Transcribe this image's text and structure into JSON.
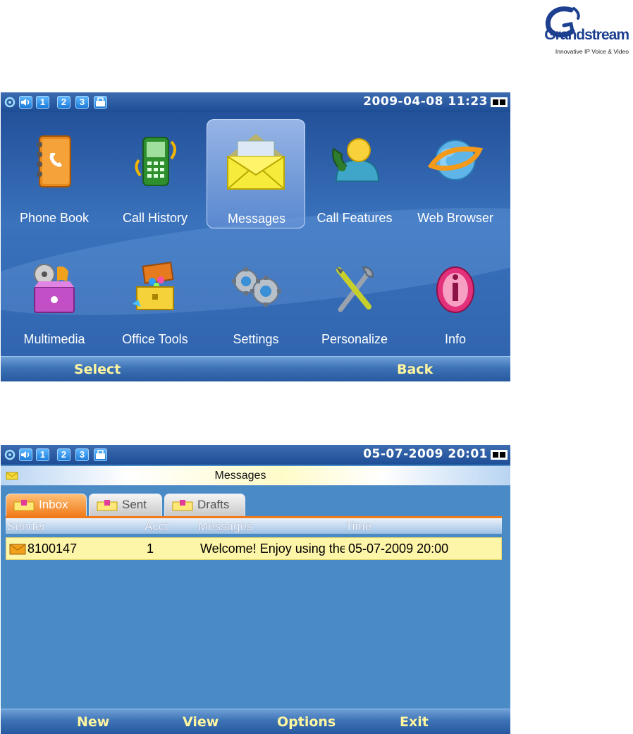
{
  "brand": {
    "logo_word": "Grandstream",
    "tagline": "Innovative IP Voice & Video"
  },
  "screen1": {
    "status": {
      "line_keys": [
        "1",
        "2",
        "3"
      ],
      "datetime": "2009-04-08 11:23"
    },
    "menu": [
      {
        "label": "Phone Book",
        "icon": "phone-book-icon"
      },
      {
        "label": "Call History",
        "icon": "call-history-icon"
      },
      {
        "label": "Messages",
        "icon": "envelope-icon",
        "selected": true
      },
      {
        "label": "Call Features",
        "icon": "call-features-icon"
      },
      {
        "label": "Web Browser",
        "icon": "web-browser-icon"
      },
      {
        "label": "Multimedia",
        "icon": "multimedia-icon"
      },
      {
        "label": "Office Tools",
        "icon": "toolbox-icon"
      },
      {
        "label": "Settings",
        "icon": "gears-icon"
      },
      {
        "label": "Personalize",
        "icon": "tools-icon"
      },
      {
        "label": "Info",
        "icon": "info-icon"
      }
    ],
    "softkeys": {
      "left": "Select",
      "right": "Back"
    }
  },
  "screen2": {
    "status": {
      "line_keys": [
        "1",
        "2",
        "3"
      ],
      "datetime": "05-07-2009 20:01"
    },
    "title": "Messages",
    "tabs": [
      {
        "label": "Inbox",
        "active": true
      },
      {
        "label": "Sent",
        "active": false
      },
      {
        "label": "Drafts",
        "active": false
      }
    ],
    "columns": [
      "Sender",
      "Acct",
      "Messages",
      "Time"
    ],
    "rows": [
      {
        "sender": "8100147",
        "acct": "1",
        "message": "Welcome! Enjoy using the",
        "time": "05-07-2009 20:00"
      }
    ],
    "softkeys": [
      "New",
      "View",
      "Options",
      "Exit"
    ]
  },
  "colors": {
    "softkey_text": "#fff6a0",
    "active_tab": "#f07a19",
    "row_highlight": "#fdf5a8",
    "screen_bg": "#4a8bc6"
  }
}
